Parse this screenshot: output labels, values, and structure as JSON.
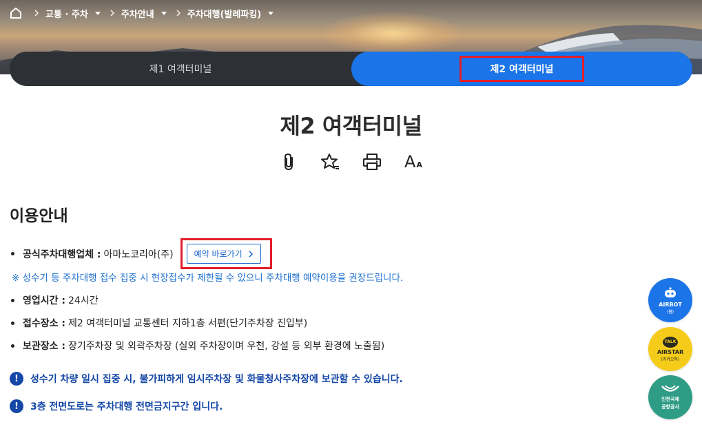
{
  "breadcrumb": {
    "items": [
      {
        "label": "교통 · 주차"
      },
      {
        "label": "주차안내"
      },
      {
        "label": "주차대행(발레파킹)"
      }
    ]
  },
  "tabs": [
    {
      "label": "제1 여객터미널",
      "active": false
    },
    {
      "label": "제2 여객터미널",
      "active": true
    }
  ],
  "page": {
    "title": "제2 여객터미널",
    "tools": [
      "clip-icon",
      "favorite-star-icon",
      "print-icon",
      "font-size-icon"
    ],
    "font_size_label": "A",
    "font_size_small": "A"
  },
  "section": {
    "title": "이용안내",
    "rows": [
      {
        "key": "공식주차대행업체 :",
        "value": "아마노코리아(주)"
      },
      {
        "key": "영업시간 :",
        "value": "24시간"
      },
      {
        "key": "접수장소 :",
        "value": "제2 여객터미널 교통센터 지하1층 서편(단기주차장 진입부)"
      },
      {
        "key": "보관장소 :",
        "value": "장기주차장 및 외곽주차장 (실외 주차장이며 우천, 강설 등 외부 환경에 노출됨)"
      }
    ],
    "reserve_button": "예약 바로가기",
    "note": "※ 성수기 등 주차대행 접수 집중 시 현장접수가 제한될 수 있으니 주차대행 예약이용을 권장드립니다.",
    "alerts": [
      "성수기 차량 일시 집중 시, 불가피하게 임시주차장 및 화물청사주차장에 보관할 수 있습니다.",
      "3층 전면도로는 주차대행 전면금지구간 입니다."
    ]
  },
  "floating": {
    "airbot": {
      "label": "AIRBOT",
      "sub": "(웹)"
    },
    "airstar": {
      "badge": "TALK",
      "label": "AIRSTAR",
      "sub": "(카카오톡)"
    },
    "iiac": {
      "line1": "인천국제",
      "line2": "공항공사"
    }
  },
  "colors": {
    "accent": "#1b74e8",
    "highlight_box": "#e21d2a",
    "note_blue": "#1b6fd0",
    "alert_navy": "#1447a6",
    "tab_bar": "#2d3136"
  }
}
